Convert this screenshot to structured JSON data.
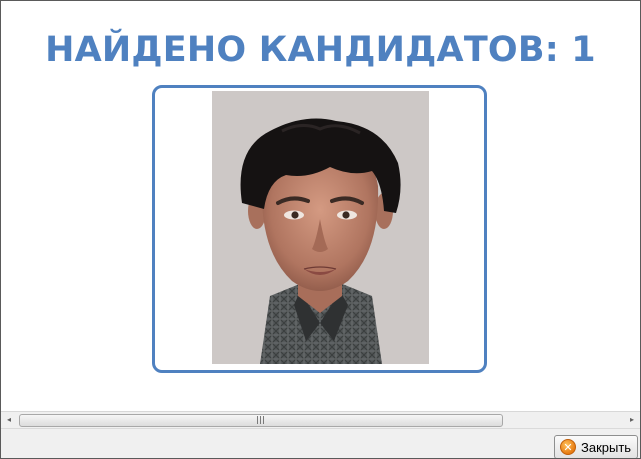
{
  "header": {
    "title": "НАЙДЕНО КАНДИДАТОВ: 1"
  },
  "candidate": {
    "photo_icon": "face-portrait"
  },
  "scrollbar": {
    "left_arrow": "◂",
    "right_arrow": "▸"
  },
  "footer": {
    "close_label": "Закрыть",
    "close_icon": "close-x-icon"
  },
  "colors": {
    "accent": "#4f81c0",
    "close_icon": "#e77b12"
  }
}
